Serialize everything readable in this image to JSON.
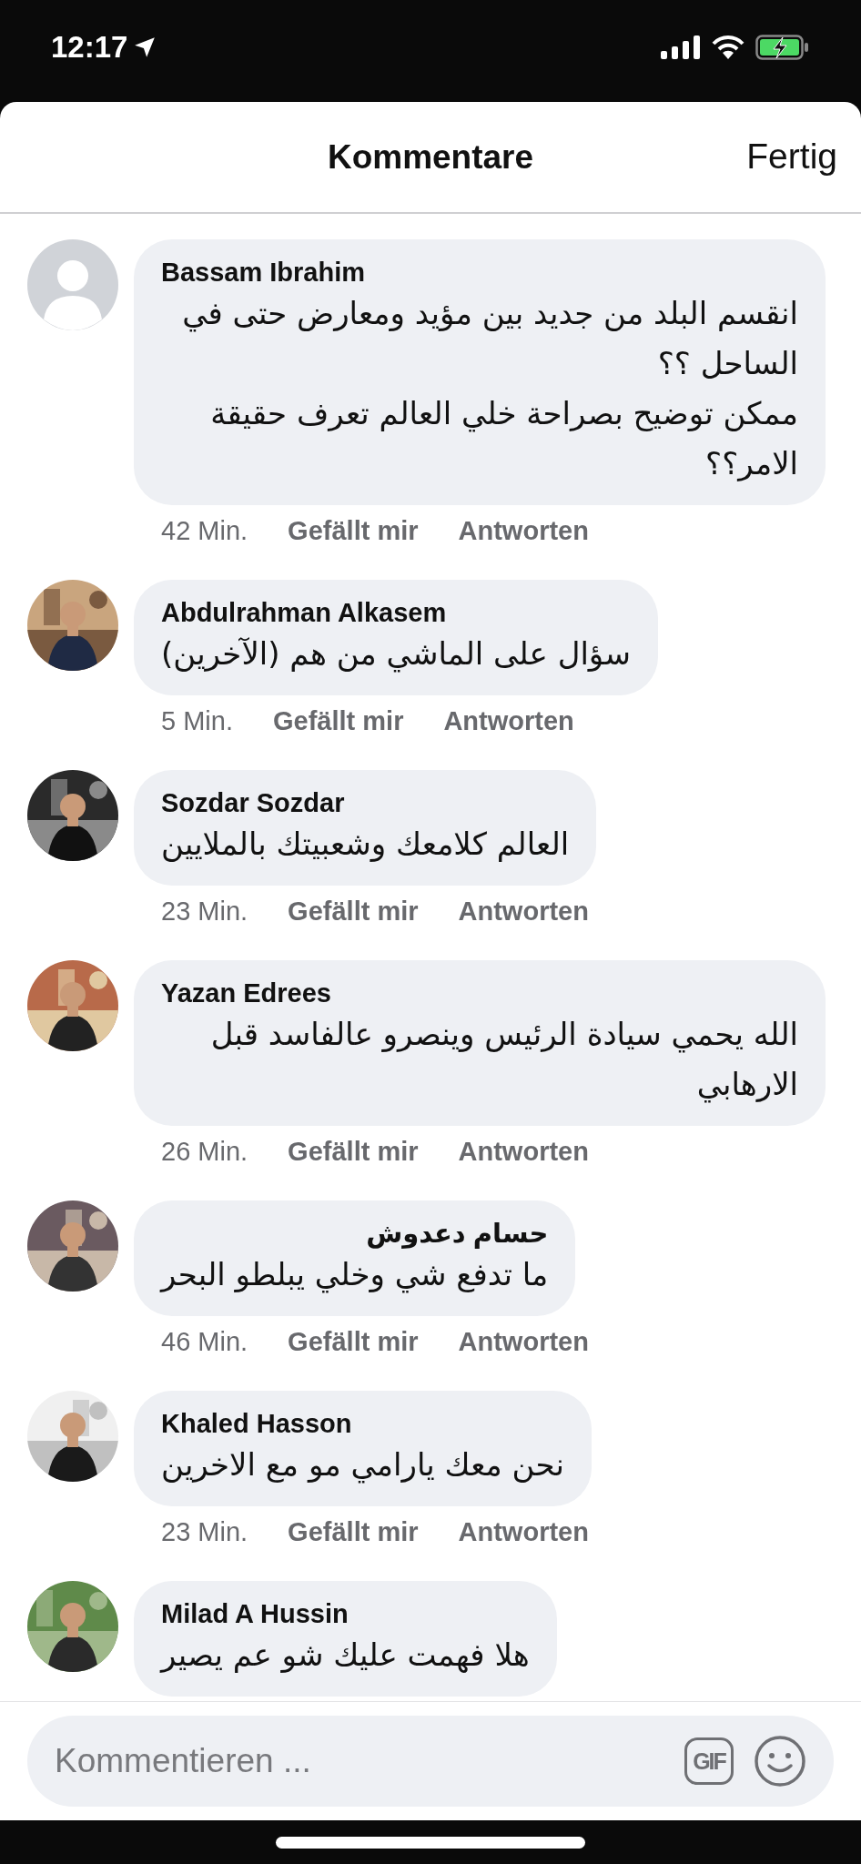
{
  "status_bar": {
    "time": "12:17"
  },
  "header": {
    "title": "Kommentare",
    "done": "Fertig"
  },
  "comments": [
    {
      "avatar": {
        "kind": "default"
      },
      "name": "Bassam Ibrahim",
      "text": "انقسم البلد من جديد بين مؤيد ومعارض حتى في الساحل ؟؟\nممكن توضيح بصراحة خلي العالم تعرف حقيقة الامر؟؟",
      "time": "42 Min.",
      "like": "Gefällt mir",
      "reply": "Antworten"
    },
    {
      "name": "Abdulrahman Alkasem",
      "text": "سؤال على الماشي من هم (الآخرين)",
      "time": "5 Min.",
      "like": "Gefällt mir",
      "reply": "Antworten"
    },
    {
      "name": "Sozdar Sozdar",
      "text": "العالم كلامعك وشعبيتك بالملايين",
      "time": "23 Min.",
      "like": "Gefällt mir",
      "reply": "Antworten"
    },
    {
      "name": "Yazan Edrees",
      "text": "الله يحمي سيادة الرئيس وينصرو عالفاسد قبل الارهابي",
      "time": "26 Min.",
      "like": "Gefällt mir",
      "reply": "Antworten"
    },
    {
      "name": "حسام دعدوش",
      "text": "ما تدفع شي وخلي يبلطو البحر",
      "time": "46 Min.",
      "like": "Gefällt mir",
      "reply": "Antworten"
    },
    {
      "name": "Khaled Hasson",
      "text": "نحن معك يارامي مو مع الاخرين",
      "time": "23 Min.",
      "like": "Gefällt mir",
      "reply": "Antworten"
    },
    {
      "name": "Milad A Hussin",
      "text": "هلا فهمت عليك شو عم يصير"
    }
  ],
  "composer": {
    "placeholder": "Kommentieren ...",
    "gif": "GIF"
  }
}
